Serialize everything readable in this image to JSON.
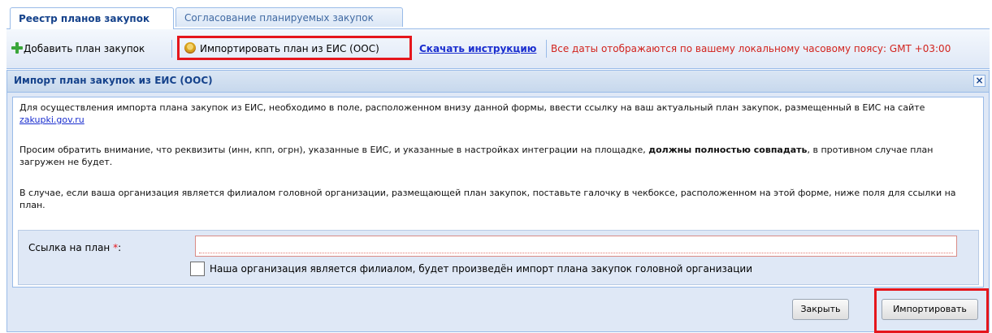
{
  "tabs": {
    "active": "Реестр планов закупок",
    "inactive": "Согласование планируемых закупок"
  },
  "toolbar": {
    "add_label": "Добавить план закупок",
    "import_label": "Импортировать план из ЕИС (ООС)",
    "instruction_link": "Скачать инструкцию",
    "timezone_note": "Все даты отображаются по вашему локальному часовому поясу: GMT +03:00"
  },
  "dialog": {
    "title": "Импорт план закупок из ЕИС (ООС)",
    "close_symbol": "×",
    "p1_text": "Для осуществления импорта плана закупок из ЕИС, необходимо в поле, расположенном внизу данной формы, ввести ссылку на ваш актуальный план закупок, размещенный в ЕИС на сайте",
    "p1_link": "zakupki.gov.ru",
    "p2_text": "Просим обратить внимание, что реквизиты (инн, кпп, огрн), указанные в ЕИС, и указанные в настройках интеграции на площадке,",
    "p2_bold": "должны полностью совпадать",
    "p2_tail": ", в противном случае план загружен не будет.",
    "p3_text": "В случае, если ваша организация является филиалом головной организации, размещающей план закупок, поставьте галочку в чекбоксе, расположенном на этой форме, ниже поля для ссылки на план.",
    "field_label": "Ссылка на план",
    "required_mark": "*",
    "field_colon": ":",
    "field_value": "",
    "checkbox_label": "Наша организация является филиалом, будет произведён импорт плана закупок головной организации",
    "btn_close": "Закрыть",
    "btn_import": "Импортировать"
  },
  "colors": {
    "highlight": "#e5161c",
    "link": "#1a2ecf",
    "panel": "#dfe8f6"
  }
}
